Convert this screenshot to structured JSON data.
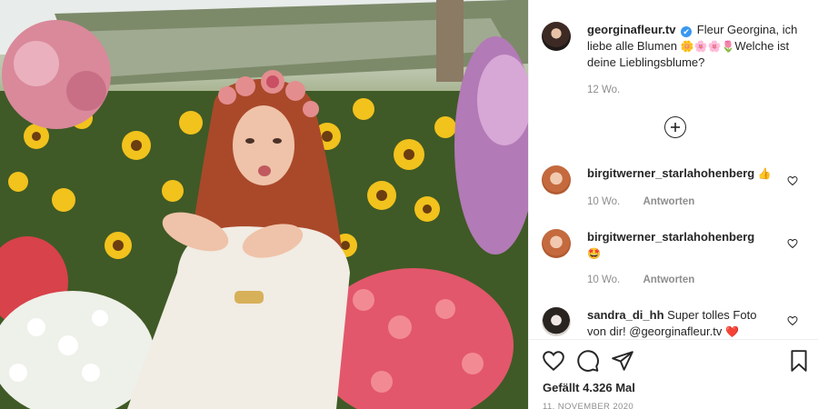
{
  "post": {
    "owner": "georginafleur.tv",
    "verified_mark": "✔",
    "caption_lead": "Fleur Georgina, ich liebe alle Blumen",
    "caption_emojis": "🌼🌸🌸🌷",
    "caption_tail": "Welche ist deine Lieblingsblume?",
    "age": "12 Wo."
  },
  "comments": [
    {
      "user": "birgitwerner_starlahohenberg",
      "text": "",
      "emoji": "👍",
      "age": "10 Wo.",
      "reply": "Antworten"
    },
    {
      "user": "birgitwerner_starlahohenberg",
      "text": "",
      "emoji": "🤩",
      "age": "10 Wo.",
      "reply": "Antworten"
    },
    {
      "user": "sandra_di_hh",
      "text": "Super tolles Foto von dir! @georginafleur.tv",
      "emoji": "❤️",
      "age": "",
      "reply": ""
    }
  ],
  "actions": {
    "like_icon": "heart-icon",
    "comment_icon": "comment-icon",
    "share_icon": "share-icon",
    "save_icon": "bookmark-icon",
    "load_more_icon": "plus-circle-icon"
  },
  "likes_text": "Gefällt 4.326 Mal",
  "date_text": "11. NOVEMBER 2020"
}
